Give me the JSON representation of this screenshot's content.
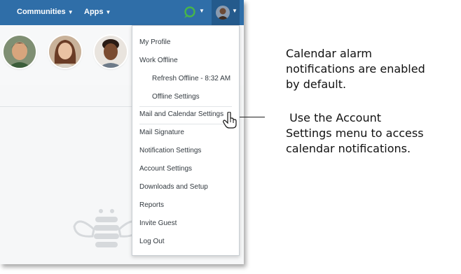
{
  "topbar": {
    "communities": "Communities",
    "apps": "Apps"
  },
  "menu": {
    "items": [
      {
        "label": "My Profile"
      },
      {
        "label": "Work Offline"
      },
      {
        "label": "Refresh Offline - 8:32 AM"
      },
      {
        "label": "Offline Settings"
      },
      {
        "label": "Mail and Calendar Settings"
      },
      {
        "label": "Mail Signature"
      },
      {
        "label": "Notification Settings"
      },
      {
        "label": "Account Settings"
      },
      {
        "label": "Downloads and Setup"
      },
      {
        "label": "Reports"
      },
      {
        "label": "Invite Guest"
      },
      {
        "label": "Log Out"
      }
    ]
  },
  "annotations": {
    "top": [
      "Calendar alarm",
      "notifications are enabled",
      "by default."
    ],
    "bottom": [
      " Use the Account",
      "Settings menu to access",
      "calendar notifications."
    ]
  },
  "icons": {
    "chat": "chat-bubble-icon",
    "user": "user-avatar-icon",
    "cursor": "pointer-hand-icon",
    "bee": "bee-logo-icon"
  },
  "colors": {
    "topbar": "#2f6ea8",
    "chat_icon": "#47b54a",
    "menu_text": "#333a40"
  }
}
